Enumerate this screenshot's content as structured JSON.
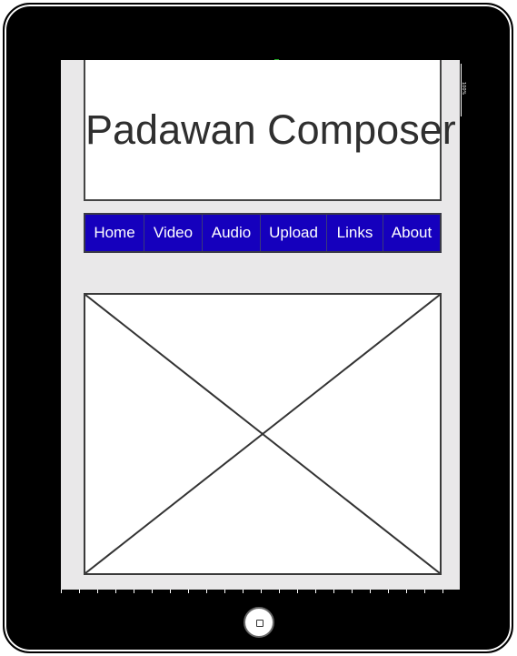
{
  "device": {
    "status_text": "100%",
    "frame_color": "#000000",
    "screen_background": "#e9e8e9"
  },
  "header": {
    "title": "Padawan Composer"
  },
  "nav": {
    "background_color": "#1500bd",
    "text_color": "#ffffff",
    "items": [
      {
        "label": "Home"
      },
      {
        "label": "Video"
      },
      {
        "label": "Audio"
      },
      {
        "label": "Upload"
      },
      {
        "label": "Links"
      },
      {
        "label": "About"
      }
    ]
  },
  "main": {
    "image_placeholder": "image-placeholder"
  },
  "icons": {
    "home_button": "home-button-icon"
  }
}
